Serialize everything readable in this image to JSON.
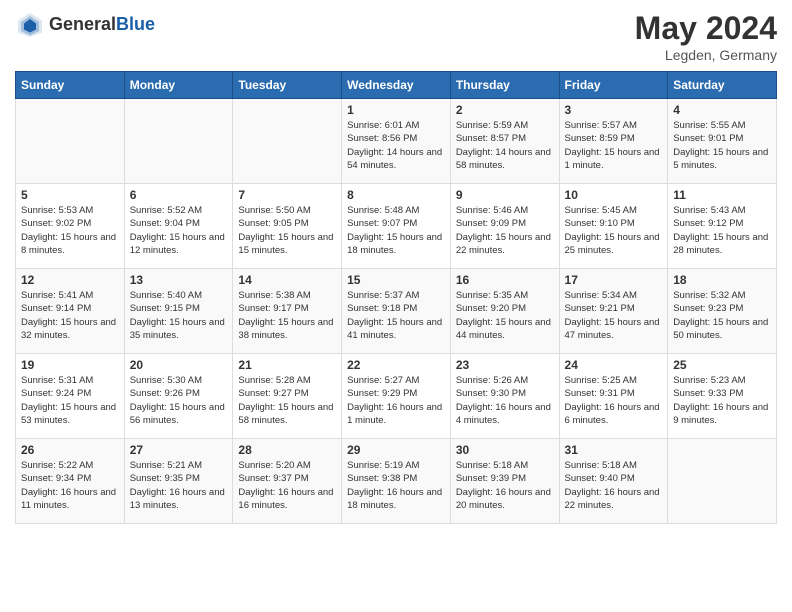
{
  "header": {
    "logo_general": "General",
    "logo_blue": "Blue",
    "month_year": "May 2024",
    "location": "Legden, Germany"
  },
  "days_of_week": [
    "Sunday",
    "Monday",
    "Tuesday",
    "Wednesday",
    "Thursday",
    "Friday",
    "Saturday"
  ],
  "weeks": [
    [
      {
        "day": "",
        "info": ""
      },
      {
        "day": "",
        "info": ""
      },
      {
        "day": "",
        "info": ""
      },
      {
        "day": "1",
        "info": "Sunrise: 6:01 AM\nSunset: 8:56 PM\nDaylight: 14 hours\nand 54 minutes."
      },
      {
        "day": "2",
        "info": "Sunrise: 5:59 AM\nSunset: 8:57 PM\nDaylight: 14 hours\nand 58 minutes."
      },
      {
        "day": "3",
        "info": "Sunrise: 5:57 AM\nSunset: 8:59 PM\nDaylight: 15 hours\nand 1 minute."
      },
      {
        "day": "4",
        "info": "Sunrise: 5:55 AM\nSunset: 9:01 PM\nDaylight: 15 hours\nand 5 minutes."
      }
    ],
    [
      {
        "day": "5",
        "info": "Sunrise: 5:53 AM\nSunset: 9:02 PM\nDaylight: 15 hours\nand 8 minutes."
      },
      {
        "day": "6",
        "info": "Sunrise: 5:52 AM\nSunset: 9:04 PM\nDaylight: 15 hours\nand 12 minutes."
      },
      {
        "day": "7",
        "info": "Sunrise: 5:50 AM\nSunset: 9:05 PM\nDaylight: 15 hours\nand 15 minutes."
      },
      {
        "day": "8",
        "info": "Sunrise: 5:48 AM\nSunset: 9:07 PM\nDaylight: 15 hours\nand 18 minutes."
      },
      {
        "day": "9",
        "info": "Sunrise: 5:46 AM\nSunset: 9:09 PM\nDaylight: 15 hours\nand 22 minutes."
      },
      {
        "day": "10",
        "info": "Sunrise: 5:45 AM\nSunset: 9:10 PM\nDaylight: 15 hours\nand 25 minutes."
      },
      {
        "day": "11",
        "info": "Sunrise: 5:43 AM\nSunset: 9:12 PM\nDaylight: 15 hours\nand 28 minutes."
      }
    ],
    [
      {
        "day": "12",
        "info": "Sunrise: 5:41 AM\nSunset: 9:14 PM\nDaylight: 15 hours\nand 32 minutes."
      },
      {
        "day": "13",
        "info": "Sunrise: 5:40 AM\nSunset: 9:15 PM\nDaylight: 15 hours\nand 35 minutes."
      },
      {
        "day": "14",
        "info": "Sunrise: 5:38 AM\nSunset: 9:17 PM\nDaylight: 15 hours\nand 38 minutes."
      },
      {
        "day": "15",
        "info": "Sunrise: 5:37 AM\nSunset: 9:18 PM\nDaylight: 15 hours\nand 41 minutes."
      },
      {
        "day": "16",
        "info": "Sunrise: 5:35 AM\nSunset: 9:20 PM\nDaylight: 15 hours\nand 44 minutes."
      },
      {
        "day": "17",
        "info": "Sunrise: 5:34 AM\nSunset: 9:21 PM\nDaylight: 15 hours\nand 47 minutes."
      },
      {
        "day": "18",
        "info": "Sunrise: 5:32 AM\nSunset: 9:23 PM\nDaylight: 15 hours\nand 50 minutes."
      }
    ],
    [
      {
        "day": "19",
        "info": "Sunrise: 5:31 AM\nSunset: 9:24 PM\nDaylight: 15 hours\nand 53 minutes."
      },
      {
        "day": "20",
        "info": "Sunrise: 5:30 AM\nSunset: 9:26 PM\nDaylight: 15 hours\nand 56 minutes."
      },
      {
        "day": "21",
        "info": "Sunrise: 5:28 AM\nSunset: 9:27 PM\nDaylight: 15 hours\nand 58 minutes."
      },
      {
        "day": "22",
        "info": "Sunrise: 5:27 AM\nSunset: 9:29 PM\nDaylight: 16 hours\nand 1 minute."
      },
      {
        "day": "23",
        "info": "Sunrise: 5:26 AM\nSunset: 9:30 PM\nDaylight: 16 hours\nand 4 minutes."
      },
      {
        "day": "24",
        "info": "Sunrise: 5:25 AM\nSunset: 9:31 PM\nDaylight: 16 hours\nand 6 minutes."
      },
      {
        "day": "25",
        "info": "Sunrise: 5:23 AM\nSunset: 9:33 PM\nDaylight: 16 hours\nand 9 minutes."
      }
    ],
    [
      {
        "day": "26",
        "info": "Sunrise: 5:22 AM\nSunset: 9:34 PM\nDaylight: 16 hours\nand 11 minutes."
      },
      {
        "day": "27",
        "info": "Sunrise: 5:21 AM\nSunset: 9:35 PM\nDaylight: 16 hours\nand 13 minutes."
      },
      {
        "day": "28",
        "info": "Sunrise: 5:20 AM\nSunset: 9:37 PM\nDaylight: 16 hours\nand 16 minutes."
      },
      {
        "day": "29",
        "info": "Sunrise: 5:19 AM\nSunset: 9:38 PM\nDaylight: 16 hours\nand 18 minutes."
      },
      {
        "day": "30",
        "info": "Sunrise: 5:18 AM\nSunset: 9:39 PM\nDaylight: 16 hours\nand 20 minutes."
      },
      {
        "day": "31",
        "info": "Sunrise: 5:18 AM\nSunset: 9:40 PM\nDaylight: 16 hours\nand 22 minutes."
      },
      {
        "day": "",
        "info": ""
      }
    ]
  ]
}
